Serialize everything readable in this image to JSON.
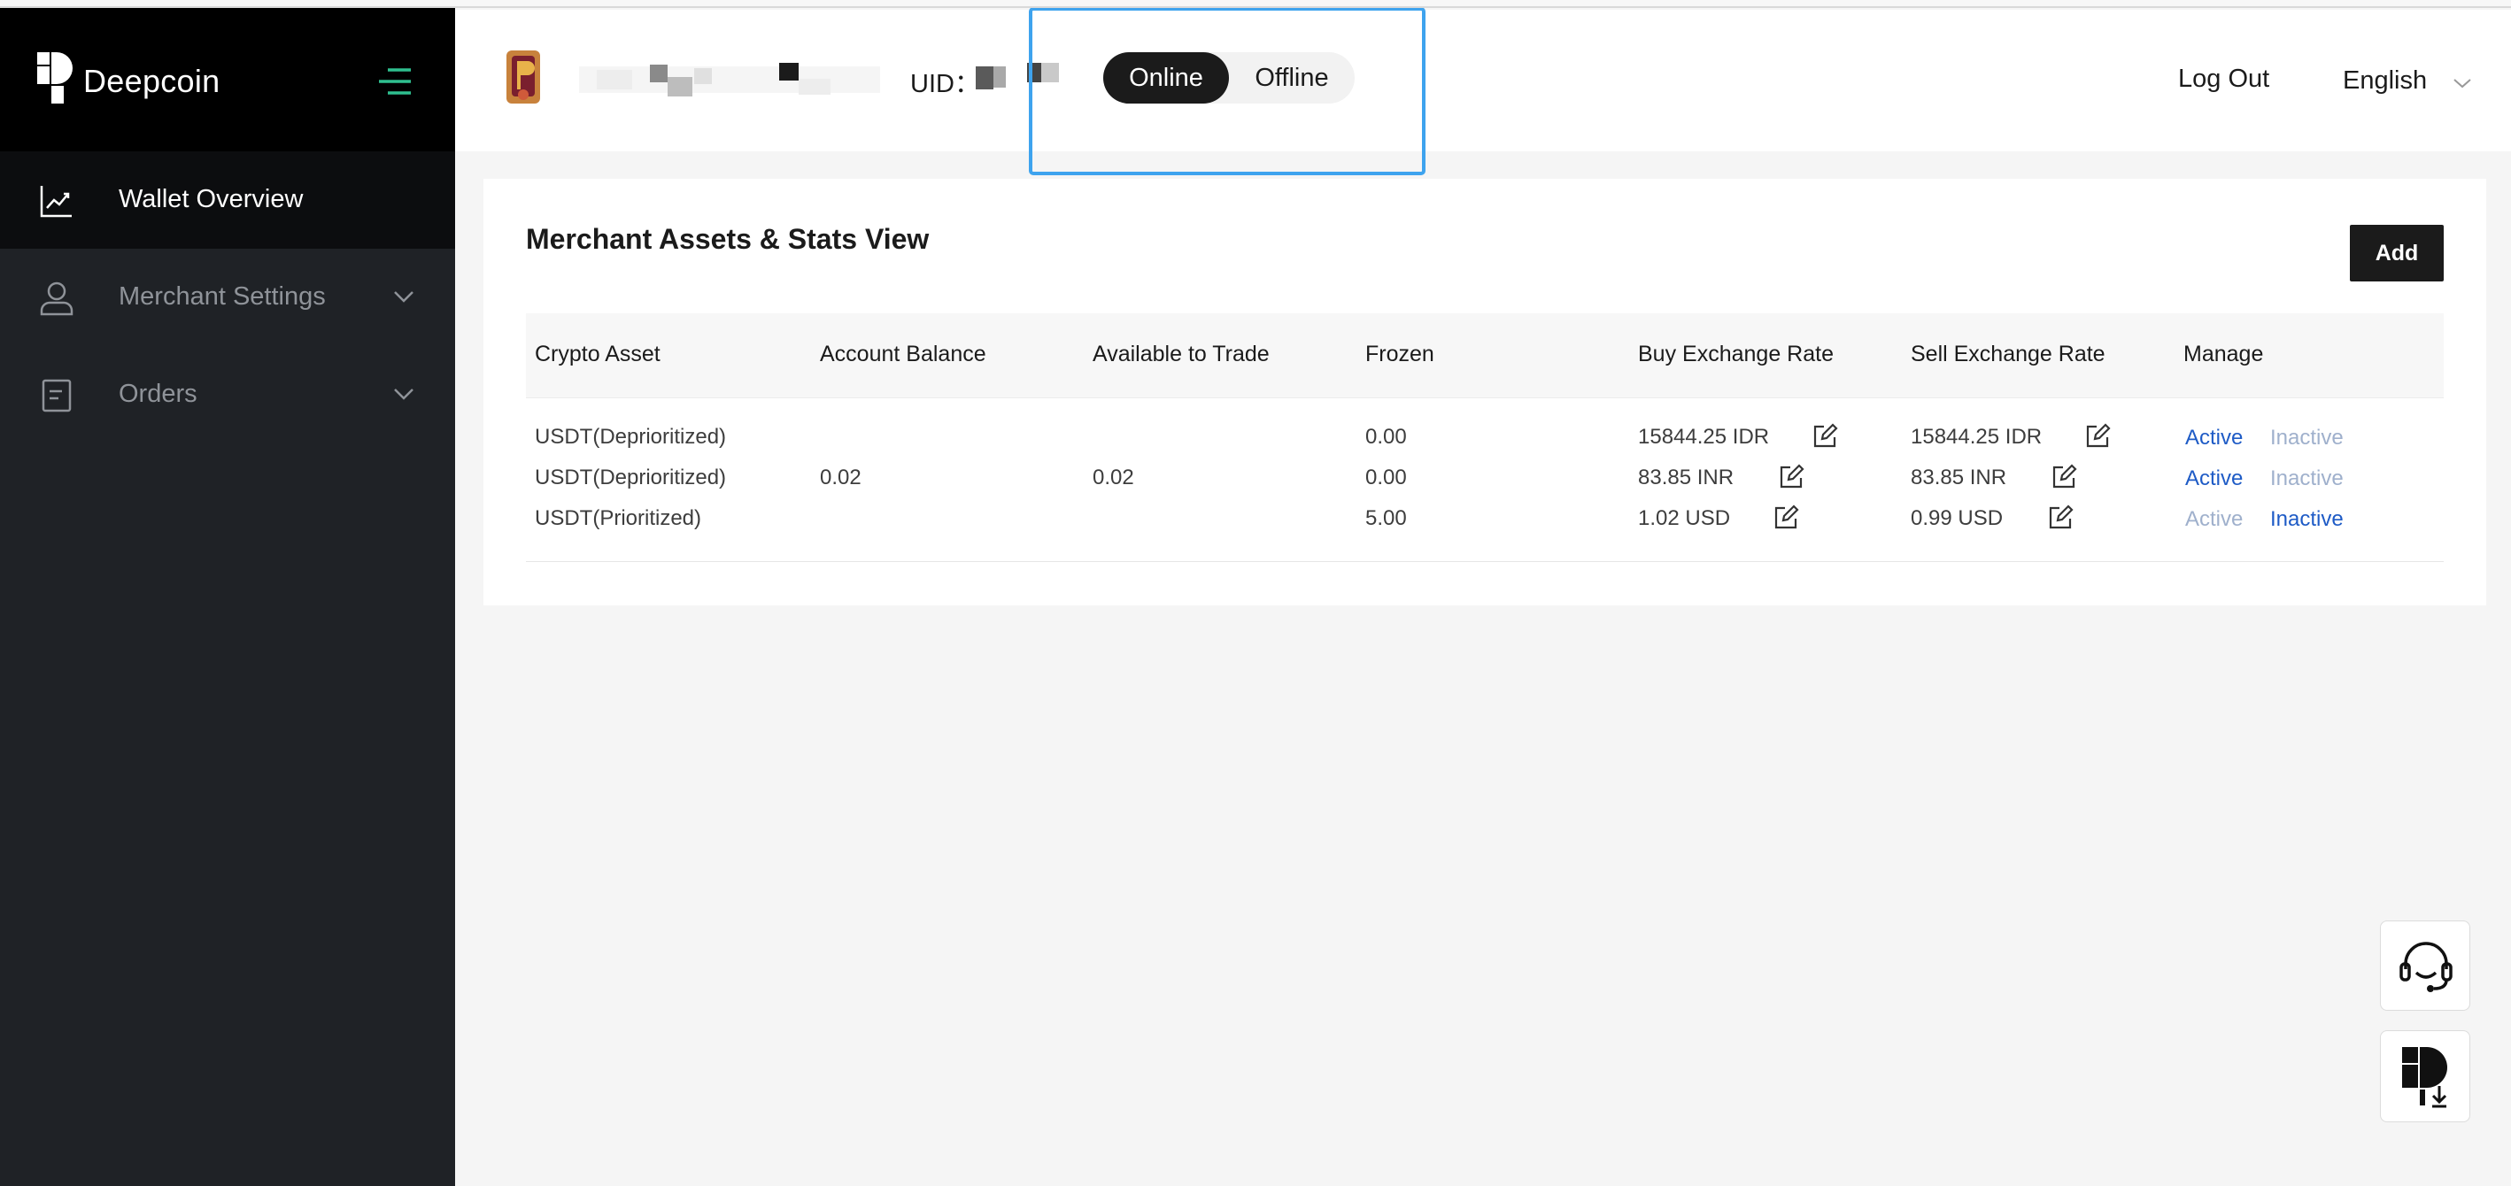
{
  "brand": {
    "name": "Deepcoin"
  },
  "sidebar": {
    "items": [
      {
        "label": "Wallet Overview",
        "icon": "chart-line-icon",
        "active": true
      },
      {
        "label": "Merchant Settings",
        "icon": "user-icon",
        "expandable": true
      },
      {
        "label": "Orders",
        "icon": "document-icon",
        "expandable": true
      }
    ]
  },
  "header": {
    "uid_label": "UID：",
    "status": {
      "online_label": "Online",
      "offline_label": "Offline",
      "selected": "Online"
    },
    "logout_label": "Log Out",
    "language": "English"
  },
  "panel": {
    "title": "Merchant Assets & Stats View",
    "add_label": "Add",
    "columns": [
      "Crypto Asset",
      "Account Balance",
      "Available to Trade",
      "Frozen",
      "Buy Exchange Rate",
      "Sell Exchange Rate",
      "Manage"
    ],
    "rows": [
      {
        "asset": "USDT(Deprioritized)",
        "balance": "",
        "available": "",
        "frozen": "0.00",
        "buy_rate": "15844.25 IDR",
        "sell_rate": "15844.25 IDR",
        "active_label": "Active",
        "inactive_label": "Inactive",
        "state": "active"
      },
      {
        "asset": "USDT(Deprioritized)",
        "balance": "0.02",
        "available": "0.02",
        "frozen": "0.00",
        "buy_rate": "83.85 INR",
        "sell_rate": "83.85 INR",
        "active_label": "Active",
        "inactive_label": "Inactive",
        "state": "active"
      },
      {
        "asset": "USDT(Prioritized)",
        "balance": "",
        "available": "",
        "frozen": "5.00",
        "buy_rate": "1.02 USD",
        "sell_rate": "0.99 USD",
        "active_label": "Active",
        "inactive_label": "Inactive",
        "state": "inactive"
      }
    ]
  },
  "floating": {
    "support_icon": "headset-icon",
    "app_download_icon": "app-download-icon"
  },
  "colors": {
    "sidebar_bg": "#1f2226",
    "brand_bg": "#000000",
    "accent_green": "#2fbf8f",
    "link_blue": "#1e5bc6",
    "highlight_blue": "#3ea3ee"
  }
}
